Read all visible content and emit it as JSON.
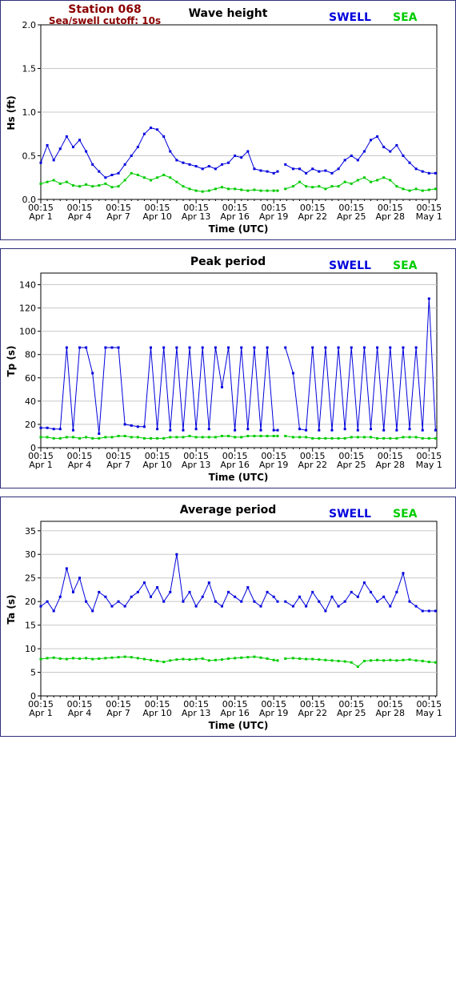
{
  "station": {
    "name": "Station 068",
    "cutoff": "Sea/swell cutoff: 10s"
  },
  "legend": {
    "swell": "SWELL",
    "sea": "SEA",
    "swell_color": "#0000dd",
    "sea_color": "#00cc00"
  },
  "xaxis": {
    "label": "Time (UTC)",
    "time_label": "00:15",
    "dates": [
      "Apr 1",
      "Apr 4",
      "Apr 7",
      "Apr 10",
      "Apr 13",
      "Apr 16",
      "Apr 19",
      "Apr 22",
      "Apr 25",
      "Apr 28",
      "May 1"
    ],
    "range_days": [
      0,
      30.6
    ]
  },
  "panels": [
    {
      "title": "Wave height",
      "ylabel": "Hs (ft)",
      "yticks": [
        "0.0",
        "0.5",
        "1.0",
        "1.5",
        "2.0"
      ],
      "ylim": [
        0,
        2
      ]
    },
    {
      "title": "Peak period",
      "ylabel": "Tp (s)",
      "yticks": [
        "0",
        "20",
        "40",
        "60",
        "80",
        "100",
        "120",
        "140"
      ],
      "ylim": [
        0,
        150
      ]
    },
    {
      "title": "Average period",
      "ylabel": "Ta (s)",
      "yticks": [
        "0",
        "5",
        "10",
        "15",
        "20",
        "25",
        "30",
        "35"
      ],
      "ylim": [
        0,
        37
      ]
    }
  ],
  "chart_data": [
    {
      "type": "line",
      "title": "Wave height",
      "ylabel": "Hs (ft)",
      "xlabel": "Time (UTC)",
      "ylim": [
        0,
        2
      ],
      "grid": true,
      "gaps_days": [
        [
          18.3,
          18.9
        ]
      ],
      "series": [
        {
          "name": "SWELL",
          "color": "#0000dd",
          "x": [
            0,
            0.5,
            1,
            1.5,
            2,
            2.5,
            3,
            3.5,
            4,
            4.5,
            5,
            5.5,
            6,
            6.5,
            7,
            7.5,
            8,
            8.5,
            9,
            9.5,
            10,
            10.5,
            11,
            11.5,
            12,
            12.5,
            13,
            13.5,
            14,
            14.5,
            15,
            15.5,
            16,
            16.5,
            17,
            17.5,
            18,
            18.3,
            18.9,
            19.5,
            20,
            20.5,
            21,
            21.5,
            22,
            22.5,
            23,
            23.5,
            24,
            24.5,
            25,
            25.5,
            26,
            26.5,
            27,
            27.5,
            28,
            28.5,
            29,
            29.5,
            30,
            30.5
          ],
          "values": [
            0.42,
            0.62,
            0.45,
            0.58,
            0.72,
            0.6,
            0.68,
            0.55,
            0.4,
            0.32,
            0.25,
            0.28,
            0.3,
            0.4,
            0.5,
            0.6,
            0.75,
            0.82,
            0.8,
            0.72,
            0.55,
            0.45,
            0.42,
            0.4,
            0.38,
            0.35,
            0.38,
            0.35,
            0.4,
            0.42,
            0.5,
            0.48,
            0.55,
            0.35,
            0.33,
            0.32,
            0.3,
            0.32,
            0.4,
            0.35,
            0.35,
            0.3,
            0.35,
            0.32,
            0.33,
            0.3,
            0.35,
            0.45,
            0.5,
            0.45,
            0.55,
            0.68,
            0.72,
            0.6,
            0.55,
            0.62,
            0.5,
            0.42,
            0.35,
            0.32,
            0.3,
            0.3
          ]
        },
        {
          "name": "SEA",
          "color": "#00cc00",
          "x": [
            0,
            0.5,
            1,
            1.5,
            2,
            2.5,
            3,
            3.5,
            4,
            4.5,
            5,
            5.5,
            6,
            6.5,
            7,
            7.5,
            8,
            8.5,
            9,
            9.5,
            10,
            10.5,
            11,
            11.5,
            12,
            12.5,
            13,
            13.5,
            14,
            14.5,
            15,
            15.5,
            16,
            16.5,
            17,
            17.5,
            18,
            18.3,
            18.9,
            19.5,
            20,
            20.5,
            21,
            21.5,
            22,
            22.5,
            23,
            23.5,
            24,
            24.5,
            25,
            25.5,
            26,
            26.5,
            27,
            27.5,
            28,
            28.5,
            29,
            29.5,
            30,
            30.5
          ],
          "values": [
            0.18,
            0.2,
            0.22,
            0.18,
            0.2,
            0.16,
            0.15,
            0.17,
            0.15,
            0.16,
            0.18,
            0.14,
            0.15,
            0.22,
            0.3,
            0.28,
            0.25,
            0.22,
            0.25,
            0.28,
            0.25,
            0.2,
            0.15,
            0.12,
            0.1,
            0.09,
            0.1,
            0.12,
            0.14,
            0.12,
            0.12,
            0.11,
            0.1,
            0.11,
            0.1,
            0.1,
            0.1,
            0.1,
            0.12,
            0.15,
            0.2,
            0.15,
            0.14,
            0.15,
            0.12,
            0.15,
            0.15,
            0.2,
            0.18,
            0.22,
            0.25,
            0.2,
            0.22,
            0.25,
            0.22,
            0.15,
            0.12,
            0.1,
            0.12,
            0.1,
            0.11,
            0.12
          ]
        }
      ]
    },
    {
      "type": "line",
      "title": "Peak period",
      "ylabel": "Tp (s)",
      "xlabel": "Time (UTC)",
      "ylim": [
        0,
        150
      ],
      "grid": true,
      "gaps_days": [
        [
          18.3,
          18.9
        ]
      ],
      "series": [
        {
          "name": "SWELL",
          "color": "#0000dd",
          "x": [
            0,
            0.5,
            1,
            1.5,
            2,
            2.5,
            3,
            3.5,
            4,
            4.5,
            5,
            5.5,
            6,
            6.5,
            7,
            7.5,
            8,
            8.5,
            9,
            9.5,
            10,
            10.5,
            11,
            11.5,
            12,
            12.5,
            13,
            13.5,
            14,
            14.5,
            15,
            15.5,
            16,
            16.5,
            17,
            17.5,
            18,
            18.3,
            18.9,
            19.5,
            20,
            20.5,
            21,
            21.5,
            22,
            22.5,
            23,
            23.5,
            24,
            24.5,
            25,
            25.5,
            26,
            26.5,
            27,
            27.5,
            28,
            28.5,
            29,
            29.5,
            30,
            30.5
          ],
          "values": [
            17,
            17,
            16,
            16,
            86,
            15,
            86,
            86,
            64,
            12,
            86,
            86,
            86,
            20,
            19,
            18,
            18,
            86,
            16,
            86,
            15,
            86,
            15,
            86,
            16,
            86,
            16,
            86,
            52,
            86,
            15,
            86,
            16,
            86,
            15,
            86,
            15,
            15,
            86,
            64,
            16,
            15,
            86,
            15,
            86,
            15,
            86,
            16,
            86,
            15,
            86,
            16,
            86,
            15,
            86,
            15,
            86,
            16,
            86,
            15,
            128,
            15
          ]
        },
        {
          "name": "SEA",
          "color": "#00cc00",
          "x": [
            0,
            0.5,
            1,
            1.5,
            2,
            2.5,
            3,
            3.5,
            4,
            4.5,
            5,
            5.5,
            6,
            6.5,
            7,
            7.5,
            8,
            8.5,
            9,
            9.5,
            10,
            10.5,
            11,
            11.5,
            12,
            12.5,
            13,
            13.5,
            14,
            14.5,
            15,
            15.5,
            16,
            16.5,
            17,
            17.5,
            18,
            18.3,
            18.9,
            19.5,
            20,
            20.5,
            21,
            21.5,
            22,
            22.5,
            23,
            23.5,
            24,
            24.5,
            25,
            25.5,
            26,
            26.5,
            27,
            27.5,
            28,
            28.5,
            29,
            29.5,
            30,
            30.5
          ],
          "values": [
            9,
            9,
            8,
            8,
            9,
            9,
            8,
            9,
            8,
            8,
            9,
            9,
            10,
            10,
            9,
            9,
            8,
            8,
            8,
            8,
            9,
            9,
            9,
            10,
            9,
            9,
            9,
            9,
            10,
            10,
            9,
            9,
            10,
            10,
            10,
            10,
            10,
            10,
            10,
            9,
            9,
            9,
            8,
            8,
            8,
            8,
            8,
            8,
            9,
            9,
            9,
            9,
            8,
            8,
            8,
            8,
            9,
            9,
            9,
            8,
            8,
            8
          ]
        }
      ]
    },
    {
      "type": "line",
      "title": "Average period",
      "ylabel": "Ta (s)",
      "xlabel": "Time (UTC)",
      "ylim": [
        0,
        37
      ],
      "grid": true,
      "gaps_days": [
        [
          18.3,
          18.9
        ]
      ],
      "series": [
        {
          "name": "SWELL",
          "color": "#0000dd",
          "x": [
            0,
            0.5,
            1,
            1.5,
            2,
            2.5,
            3,
            3.5,
            4,
            4.5,
            5,
            5.5,
            6,
            6.5,
            7,
            7.5,
            8,
            8.5,
            9,
            9.5,
            10,
            10.5,
            11,
            11.5,
            12,
            12.5,
            13,
            13.5,
            14,
            14.5,
            15,
            15.5,
            16,
            16.5,
            17,
            17.5,
            18,
            18.3,
            18.9,
            19.5,
            20,
            20.5,
            21,
            21.5,
            22,
            22.5,
            23,
            23.5,
            24,
            24.5,
            25,
            25.5,
            26,
            26.5,
            27,
            27.5,
            28,
            28.5,
            29,
            29.5,
            30,
            30.5
          ],
          "values": [
            19,
            20,
            18,
            21,
            27,
            22,
            25,
            20,
            18,
            22,
            21,
            19,
            20,
            19,
            21,
            22,
            24,
            21,
            23,
            20,
            22,
            30,
            20,
            22,
            19,
            21,
            24,
            20,
            19,
            22,
            21,
            20,
            23,
            20,
            19,
            22,
            21,
            20,
            20,
            19,
            21,
            19,
            22,
            20,
            18,
            21,
            19,
            20,
            22,
            21,
            24,
            22,
            20,
            21,
            19,
            22,
            26,
            20,
            19,
            18,
            18,
            18
          ]
        },
        {
          "name": "SEA",
          "color": "#00cc00",
          "x": [
            0,
            0.5,
            1,
            1.5,
            2,
            2.5,
            3,
            3.5,
            4,
            4.5,
            5,
            5.5,
            6,
            6.5,
            7,
            7.5,
            8,
            8.5,
            9,
            9.5,
            10,
            10.5,
            11,
            11.5,
            12,
            12.5,
            13,
            13.5,
            14,
            14.5,
            15,
            15.5,
            16,
            16.5,
            17,
            17.5,
            18,
            18.3,
            18.9,
            19.5,
            20,
            20.5,
            21,
            21.5,
            22,
            22.5,
            23,
            23.5,
            24,
            24.5,
            25,
            25.5,
            26,
            26.5,
            27,
            27.5,
            28,
            28.5,
            29,
            29.5,
            30,
            30.5
          ],
          "values": [
            7.8,
            8,
            8.1,
            7.9,
            7.8,
            8,
            7.9,
            8,
            7.8,
            7.9,
            8,
            8.1,
            8.2,
            8.3,
            8.2,
            8,
            7.8,
            7.6,
            7.4,
            7.2,
            7.5,
            7.7,
            7.8,
            7.7,
            7.8,
            7.9,
            7.5,
            7.6,
            7.7,
            7.9,
            8,
            8.1,
            8.2,
            8.3,
            8.1,
            7.9,
            7.6,
            7.5,
            7.9,
            8,
            7.9,
            7.8,
            7.8,
            7.7,
            7.6,
            7.5,
            7.4,
            7.3,
            7.1,
            6.2,
            7.4,
            7.5,
            7.6,
            7.5,
            7.6,
            7.5,
            7.6,
            7.7,
            7.5,
            7.4,
            7.2,
            7.1
          ]
        }
      ]
    }
  ]
}
